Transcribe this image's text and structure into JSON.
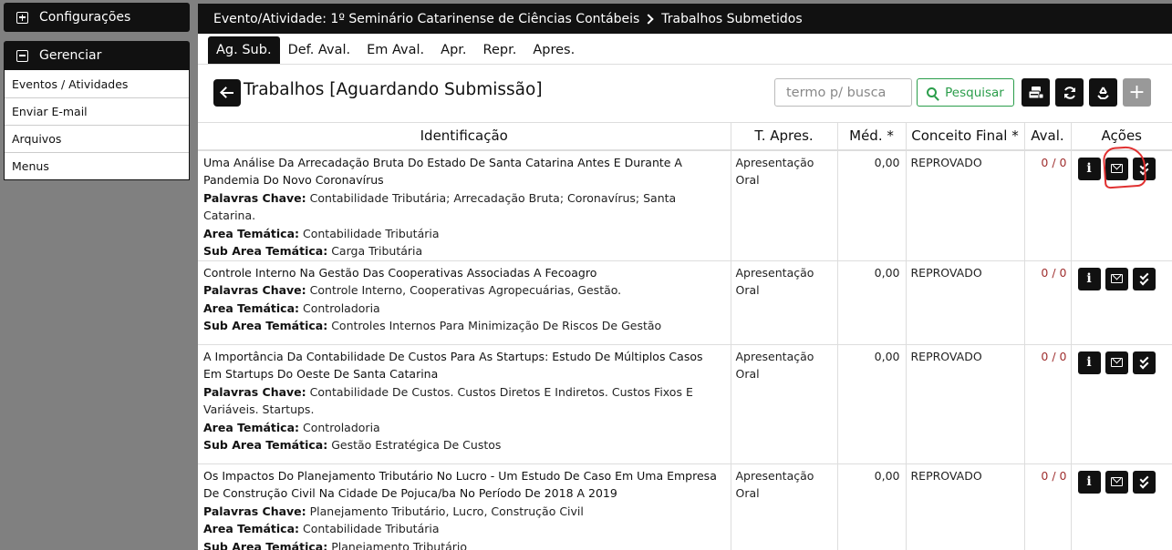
{
  "sidebar": {
    "configuracoes_label": "Configurações",
    "gerenciar_label": "Gerenciar",
    "items": [
      {
        "label": "Eventos / Atividades"
      },
      {
        "label": "Enviar E-mail"
      },
      {
        "label": "Arquivos"
      },
      {
        "label": "Menus"
      }
    ]
  },
  "breadcrumb": {
    "event": "Evento/Atividade: 1º Seminário Catarinense de Ciências Contábeis",
    "page": "Trabalhos Submetidos"
  },
  "tabs": [
    {
      "label": "Ag. Sub.",
      "active": true
    },
    {
      "label": "Def. Aval."
    },
    {
      "label": "Em Aval."
    },
    {
      "label": "Apr."
    },
    {
      "label": "Repr."
    },
    {
      "label": "Apres."
    }
  ],
  "toolbar": {
    "title": "Trabalhos [Aguardando Submissão]",
    "search_placeholder": "termo p/ busca",
    "search_button": "Pesquisar"
  },
  "table": {
    "headers": {
      "identificacao": "Identificação",
      "tipo": "T. Apres.",
      "media": "Méd. *",
      "conceito": "Conceito Final *",
      "avaliacoes": "Aval.",
      "acoes": "Ações"
    },
    "field_labels": {
      "palavras": "Palavras Chave:",
      "area": "Area Temática:",
      "subarea": "Sub Area Temática:"
    },
    "rows": [
      {
        "title": "Uma Análise Da Arrecadação Bruta Do Estado De Santa Catarina Antes E Durante A Pandemia Do Novo Coronavírus",
        "palavras": "Contabilidade Tributária; Arrecadação Bruta; Coronavírus; Santa Catarina.",
        "area": "Contabilidade Tributária",
        "subarea": "Carga Tributária",
        "tipo": "Apresentação Oral",
        "media": "0,00",
        "conceito": "REPROVADO",
        "aval": "0 / 0"
      },
      {
        "title": "Controle Interno Na Gestão Das Cooperativas Associadas A Fecoagro",
        "palavras": "Controle Interno, Cooperativas Agropecuárias, Gestão.",
        "area": "Controladoria",
        "subarea": "Controles Internos Para Minimização De Riscos De Gestão",
        "tipo": "Apresentação Oral",
        "media": "0,00",
        "conceito": "REPROVADO",
        "aval": "0 / 0"
      },
      {
        "title": "A Importância Da Contabilidade De Custos Para As Startups: Estudo De Múltiplos Casos Em Startups Do Oeste De Santa Catarina",
        "palavras": "Contabilidade De Custos. Custos Diretos E Indiretos. Custos Fixos E Variáveis. Startups.",
        "area": "Controladoria",
        "subarea": "Gestão Estratégica De Custos",
        "tipo": "Apresentação Oral",
        "media": "0,00",
        "conceito": "REPROVADO",
        "aval": "0 / 0"
      },
      {
        "title": "Os Impactos Do Planejamento Tributário No Lucro - Um Estudo De Caso Em Uma Empresa De Construção Civil Na Cidade De Pojuca/ba No Período De 2018 A 2019",
        "palavras": "Planejamento Tributário, Lucro, Construção Civil",
        "area": "Contabilidade Tributária",
        "subarea": "Planejamento Tributário",
        "tipo": "Apresentação Oral",
        "media": "0,00",
        "conceito": "REPROVADO",
        "aval": "0 / 0"
      }
    ]
  }
}
